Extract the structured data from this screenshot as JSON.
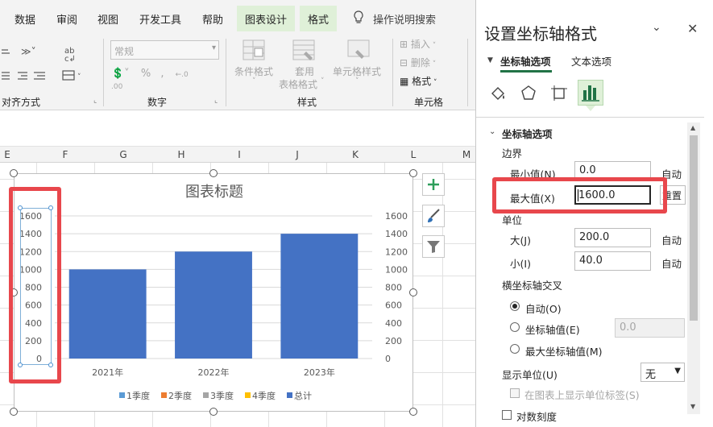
{
  "ribbon_tabs": [
    "数据",
    "审阅",
    "视图",
    "开发工具",
    "帮助",
    "图表设计",
    "格式"
  ],
  "tell_me": "操作说明搜索",
  "ribbon": {
    "align_group": "对齐方式",
    "number_format_value": "常规",
    "number_group": "数字",
    "cond_format": "条件格式",
    "table_format_line1": "套用",
    "table_format_line2": "表格格式",
    "cell_styles": "单元格样式",
    "styles_group": "样式",
    "insert": "插入",
    "delete": "删除",
    "format": "格式",
    "cells_group": "单元格"
  },
  "columns": [
    "E",
    "F",
    "G",
    "H",
    "I",
    "J",
    "K",
    "L",
    "M"
  ],
  "chart_data": {
    "type": "bar",
    "title": "图表标题",
    "categories": [
      "2021年",
      "2022年",
      "2023年"
    ],
    "series": [
      {
        "name": "1季度",
        "values": [],
        "color": "#5b9bd5"
      },
      {
        "name": "2季度",
        "values": [],
        "color": "#ed7d31"
      },
      {
        "name": "3季度",
        "values": [],
        "color": "#a5a5a5"
      },
      {
        "name": "4季度",
        "values": [],
        "color": "#ffc000"
      },
      {
        "name": "总计",
        "values": [
          1000,
          1200,
          1400
        ],
        "color": "#4472c4"
      }
    ],
    "ylim": [
      0,
      1600
    ],
    "yticks": [
      "1600",
      "1400",
      "1200",
      "1000",
      "800",
      "600",
      "400",
      "200",
      "0"
    ],
    "y2ticks": [
      "1600",
      "1400",
      "1200",
      "1000",
      "800",
      "600",
      "400",
      "200",
      "0"
    ],
    "legend_position": "bottom",
    "grid": true
  },
  "pane": {
    "title": "设置坐标轴格式",
    "tab_axis_options": "坐标轴选项",
    "tab_text_options": "文本选项",
    "section_axis_options": "坐标轴选项",
    "bounds_label": "边界",
    "min_label": "最小值(N)",
    "min_value": "0.0",
    "min_auto": "自动",
    "max_label": "最大值(X)",
    "max_value": "1600.0",
    "max_reset": "重置",
    "units_label": "单位",
    "major_label": "大(J)",
    "major_value": "200.0",
    "major_auto": "自动",
    "minor_label": "小(I)",
    "minor_value": "40.0",
    "minor_auto": "自动",
    "cross_label": "横坐标轴交叉",
    "cross_auto": "自动(O)",
    "cross_value_label": "坐标轴值(E)",
    "cross_value": "0.0",
    "cross_max": "最大坐标轴值(M)",
    "display_units_label": "显示单位(U)",
    "display_units_value": "无",
    "show_units_label": "在图表上显示单位标签(S)",
    "log_scale_label": "对数刻度"
  }
}
